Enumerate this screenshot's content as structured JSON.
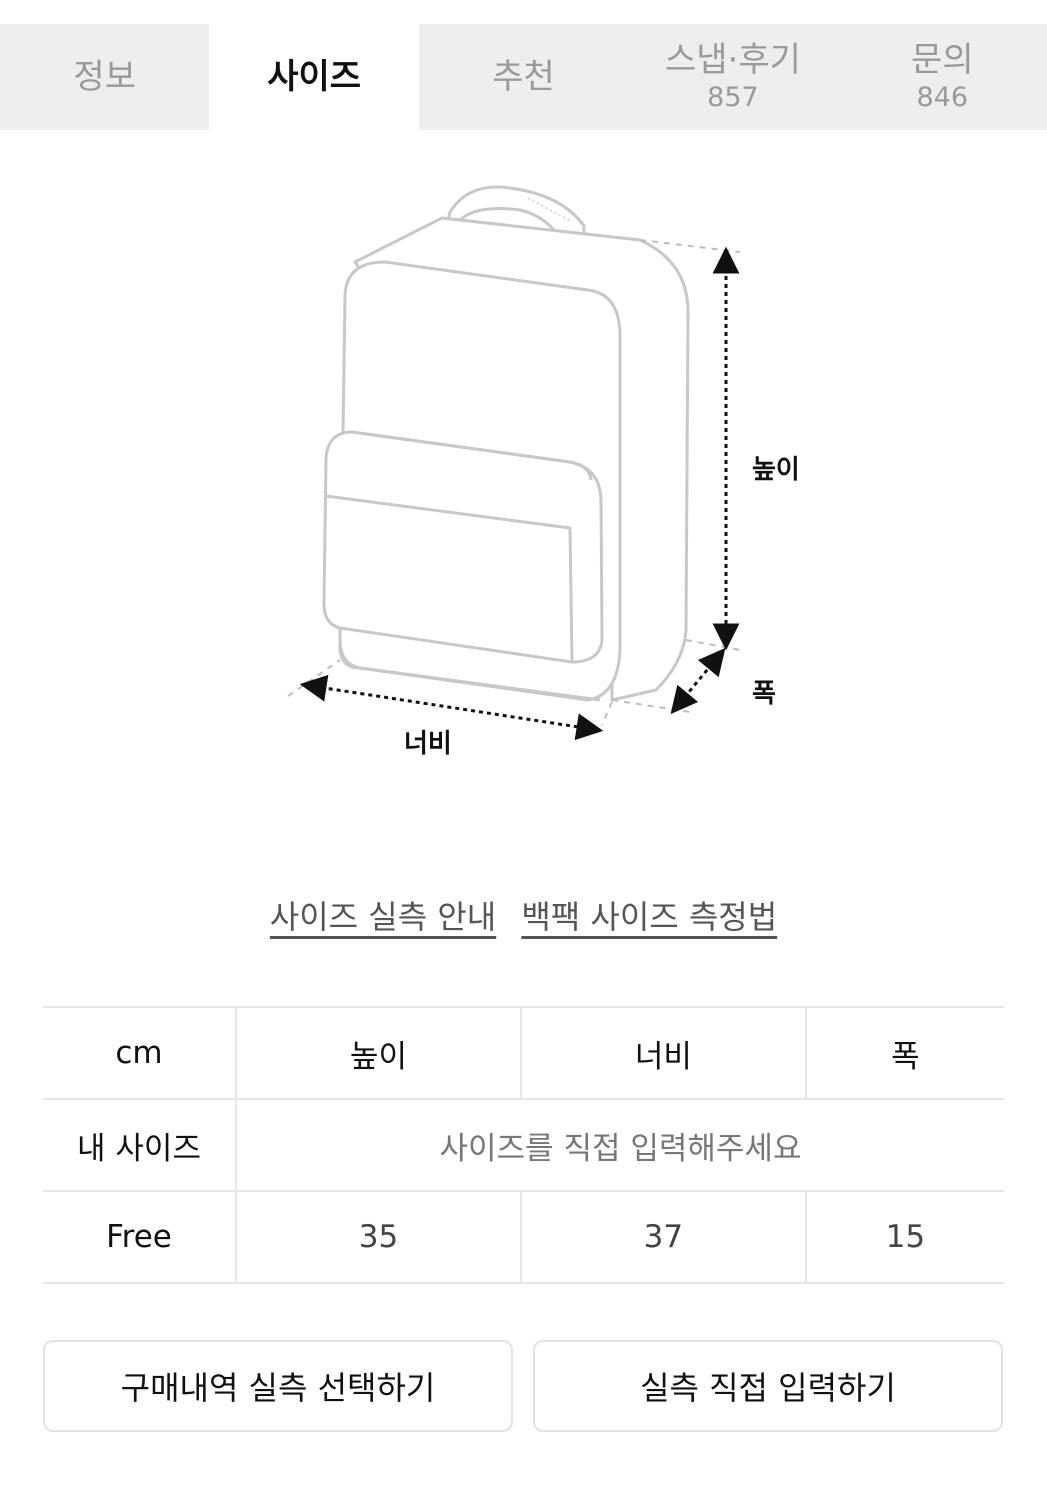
{
  "tabs": [
    {
      "label": "정보",
      "count": null
    },
    {
      "label": "사이즈",
      "count": null
    },
    {
      "label": "추천",
      "count": null
    },
    {
      "label": "스냅·후기",
      "count": "857"
    },
    {
      "label": "문의",
      "count": "846"
    }
  ],
  "illustration": {
    "height_label": "높이",
    "depth_label": "폭",
    "width_label": "너비"
  },
  "links": {
    "guide": "사이즈 실측 안내",
    "method": "백팩 사이즈 측정법"
  },
  "table": {
    "headers": [
      "cm",
      "높이",
      "너비",
      "폭"
    ],
    "my_size_label": "내 사이즈",
    "my_size_hint": "사이즈를 직접 입력해주세요",
    "rows": [
      {
        "name": "Free",
        "values": [
          "35",
          "37",
          "15"
        ]
      }
    ]
  },
  "buttons": {
    "history": "구매내역 실측 선택하기",
    "manual": "실측 직접 입력하기"
  }
}
